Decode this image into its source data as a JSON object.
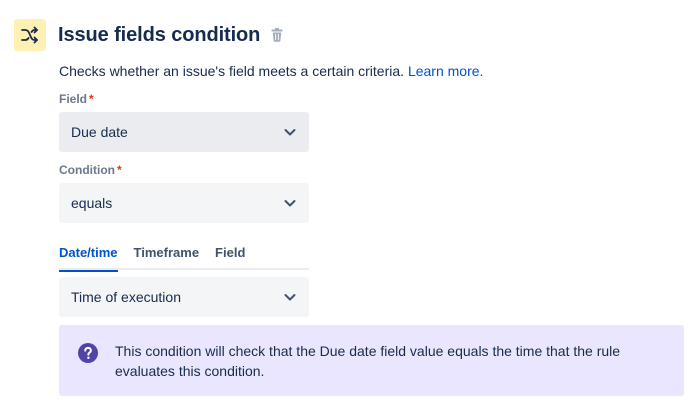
{
  "header": {
    "title": "Issue fields condition",
    "icon": "shuffle-icon",
    "delete_icon": "trash-icon"
  },
  "description": {
    "text": "Checks whether an issue's field meets a certain criteria.",
    "link": "Learn more."
  },
  "field": {
    "label": "Field",
    "required_mark": "*",
    "value": "Due date"
  },
  "condition": {
    "label": "Condition",
    "required_mark": "*",
    "value": "equals"
  },
  "tabs": [
    {
      "label": "Date/time",
      "active": true
    },
    {
      "label": "Timeframe",
      "active": false
    },
    {
      "label": "Field",
      "active": false
    }
  ],
  "value_select": {
    "value": "Time of execution"
  },
  "info": {
    "icon": "question-circle-icon",
    "line1": "This condition will check that the Due date field value equals the time that the rule",
    "line2": "evaluates this condition."
  },
  "colors": {
    "accent": "#0052cc",
    "header_icon_bg": "#fff0b3",
    "info_bg": "#eae6ff",
    "info_icon": "#5243aa",
    "required": "#de350b"
  }
}
